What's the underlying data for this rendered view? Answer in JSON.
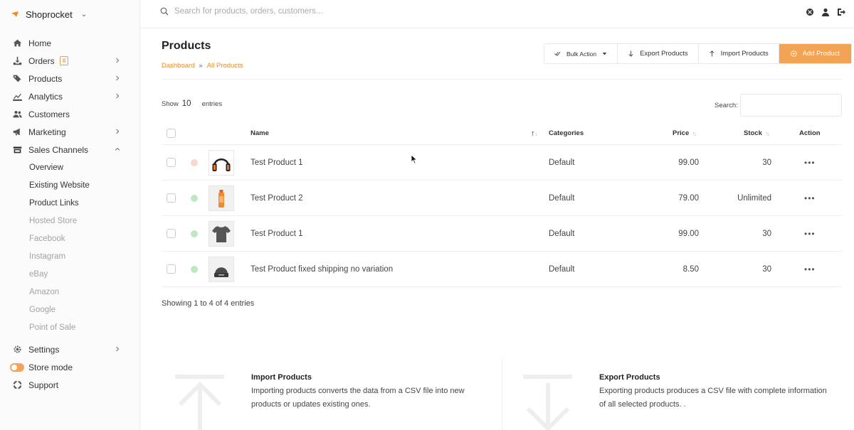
{
  "brand": {
    "name": "Shoprocket"
  },
  "sidebar": {
    "items": [
      {
        "label": "Home",
        "icon": "home-icon"
      },
      {
        "label": "Orders",
        "badge": "8",
        "icon": "download-icon"
      },
      {
        "label": "Products",
        "icon": "tags-icon"
      },
      {
        "label": "Analytics",
        "icon": "chart-icon"
      },
      {
        "label": "Customers",
        "icon": "users-icon"
      },
      {
        "label": "Marketing",
        "icon": "megaphone-icon"
      },
      {
        "label": "Sales Channels",
        "icon": "store-icon"
      }
    ],
    "sales_channels": [
      "Overview",
      "Existing Website",
      "Product Links",
      "Hosted Store",
      "Facebook",
      "Instagram",
      "eBay",
      "Amazon",
      "Google",
      "Point of Sale"
    ],
    "bottom": [
      {
        "label": "Settings",
        "icon": "gear-icon"
      },
      {
        "label": "Store mode",
        "icon": "toggle-icon"
      },
      {
        "label": "Support",
        "icon": "lifebuoy-icon"
      }
    ]
  },
  "topbar": {
    "search_placeholder": "Search for products, orders, customers..."
  },
  "page": {
    "title": "Products",
    "breadcrumb": [
      "Dashboard",
      "»",
      "All Products"
    ],
    "actions": {
      "bulk": "Bulk Action",
      "export": "Export Products",
      "import": "Import Products",
      "add": "Add Product"
    }
  },
  "table_controls": {
    "show": "Show",
    "count": "10",
    "entries": "entries",
    "search_label": "Search:"
  },
  "table": {
    "headers": {
      "name": "Name",
      "categories": "Categories",
      "price": "Price",
      "stock": "Stock",
      "action": "Action"
    },
    "rows": [
      {
        "name": "Test Product 1",
        "category": "Default",
        "price": "99.00",
        "stock": "30",
        "status_color": "#f7d9cf",
        "thumb": "headphones"
      },
      {
        "name": "Test Product 2",
        "category": "Default",
        "price": "79.00",
        "stock": "Unlimited",
        "status_color": "#bfe8bf",
        "thumb": "bottle"
      },
      {
        "name": "Test Product 1",
        "category": "Default",
        "price": "99.00",
        "stock": "30",
        "status_color": "#bfe8bf",
        "thumb": "tshirt"
      },
      {
        "name": "Test Product fixed shipping no variation",
        "category": "Default",
        "price": "8.50",
        "stock": "30",
        "status_color": "#bfe8bf",
        "thumb": "beanie"
      }
    ],
    "footer": "Showing 1 to 4 of 4 entries"
  },
  "panels": {
    "import": {
      "title": "Import Products",
      "text": "Importing products converts the data from a CSV file into new products or updates existing ones."
    },
    "export": {
      "title": "Export Products",
      "text": "Exporting products produces a CSV file with complete information of all selected products. ."
    }
  },
  "colors": {
    "accent": "#f3a354",
    "link": "#e88a2c"
  }
}
